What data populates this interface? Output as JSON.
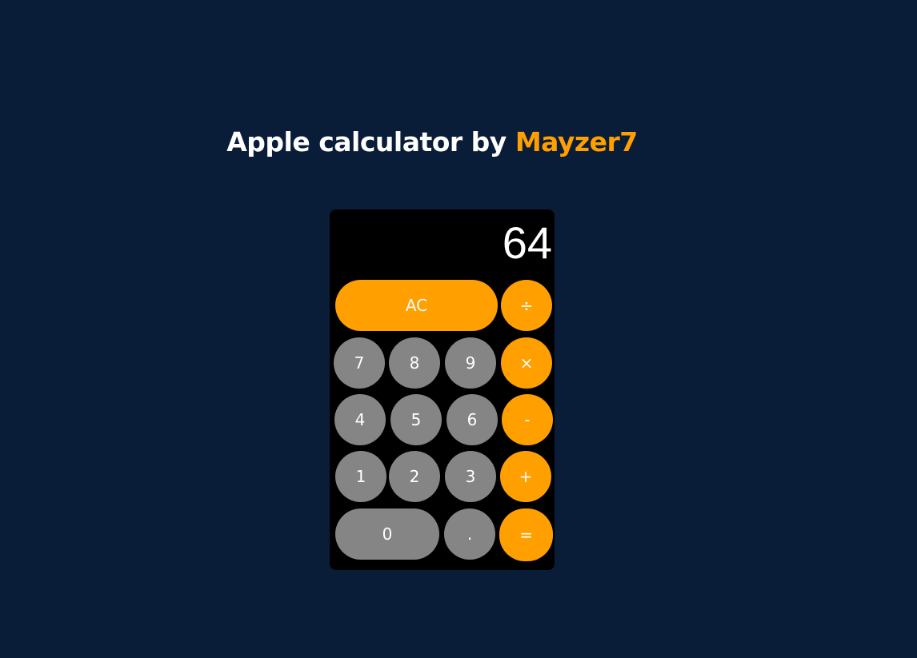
{
  "header": {
    "title_prefix": "Apple calculator by ",
    "title_author": "Mayzer7"
  },
  "calculator": {
    "display_value": "64",
    "buttons": {
      "clear": "AC",
      "divide": "÷",
      "multiply": "×",
      "subtract": "-",
      "add": "+",
      "equals": "=",
      "decimal": ".",
      "digit_0": "0",
      "digit_1": "1",
      "digit_2": "2",
      "digit_3": "3",
      "digit_4": "4",
      "digit_5": "5",
      "digit_6": "6",
      "digit_7": "7",
      "digit_8": "8",
      "digit_9": "9"
    }
  },
  "colors": {
    "background": "#0a1d38",
    "accent": "#ffa000",
    "number_button": "#858585",
    "calculator_body": "#000000"
  }
}
